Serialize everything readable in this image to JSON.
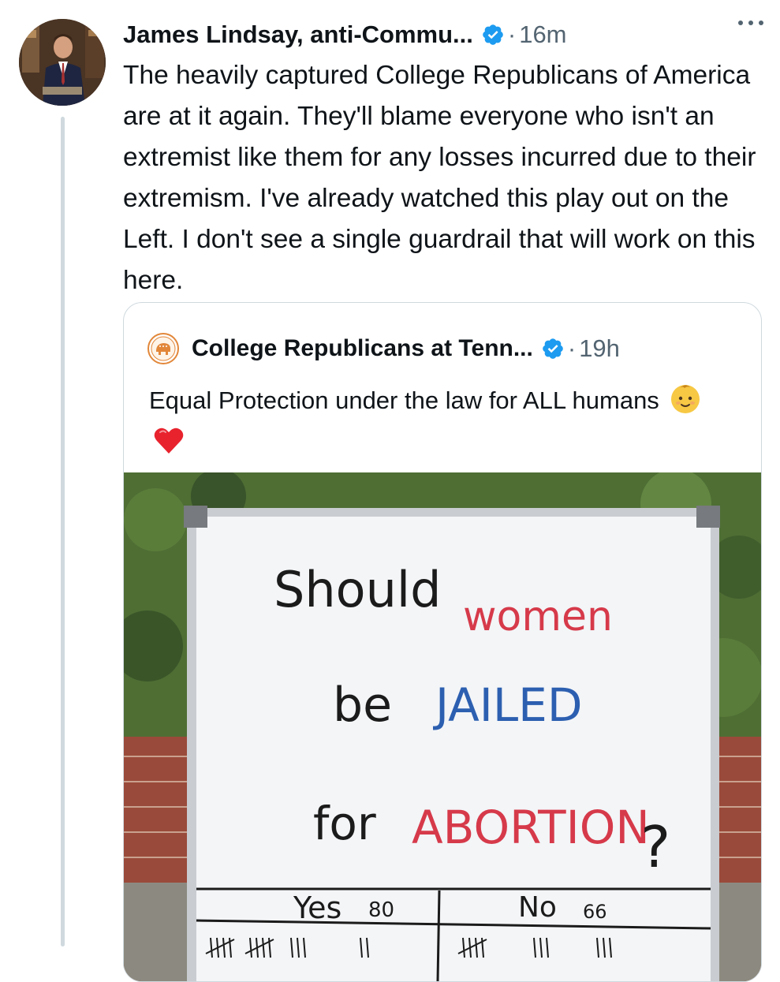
{
  "tweet": {
    "author_name": "James Lindsay, anti-Commu...",
    "separator": "·",
    "time": "16m",
    "text": "The heavily captured College Republicans of America are at it again. They'll blame everyone who isn't an extremist like them for any losses incurred due to their extremism. I've already watched this play out on the Left. I don't see a single guardrail that will work on this here.",
    "verified": true,
    "more_icon": "more-horizontal-icon"
  },
  "quote": {
    "author_name": "College Republicans at Tenn...",
    "separator": "·",
    "time": "19h",
    "text": "Equal Protection under the law for ALL humans",
    "emojis": [
      "baby-emoji",
      "red-heart-emoji"
    ],
    "verified": true
  },
  "photo": {
    "whiteboard": {
      "word_should": "Should",
      "word_women": "women",
      "word_be": "be",
      "word_jailed": "JAILED",
      "word_for": "for",
      "word_abortion": "ABORTION",
      "word_question": "?",
      "yes_label": "Yes",
      "yes_count": "80",
      "no_label": "No",
      "no_count": "66"
    }
  },
  "colors": {
    "text": "#0f1419",
    "secondary": "#536471",
    "verified_blue": "#1d9bf0",
    "border": "#cfd9de",
    "board_red": "#d63a4a",
    "board_blue": "#2c5fb0"
  }
}
